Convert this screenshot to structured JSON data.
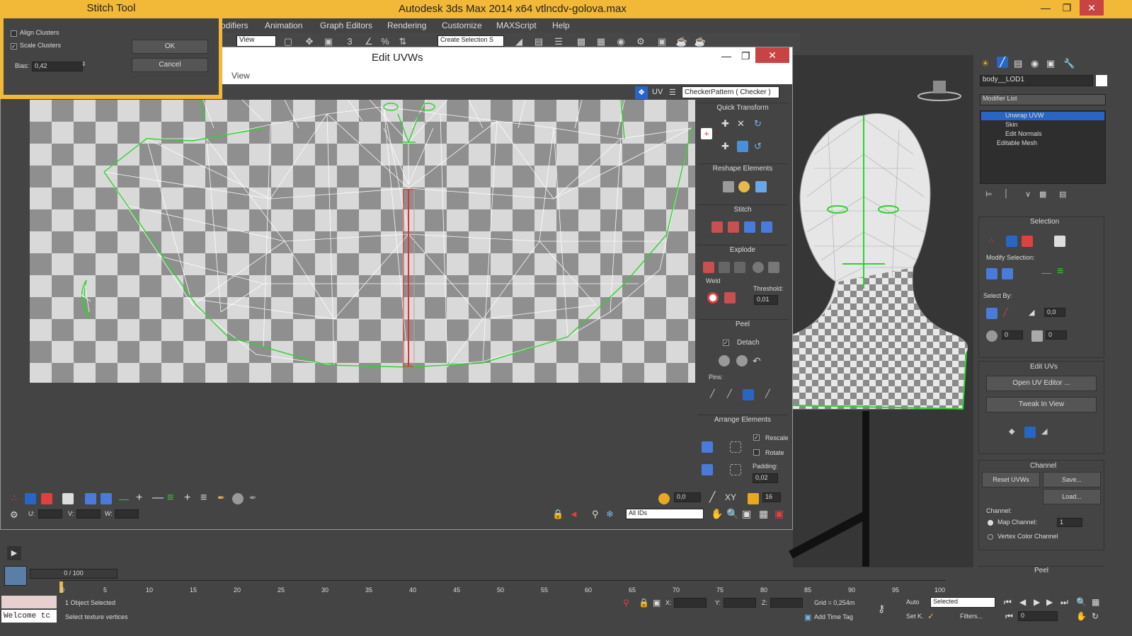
{
  "app": {
    "title": "Autodesk 3ds Max  2014 x64     vtlncdv-golova.max"
  },
  "menu": [
    "odifiers",
    "Animation",
    "Graph Editors",
    "Rendering",
    "Customize",
    "MAXScript",
    "Help"
  ],
  "toolbar": {
    "view_select": "View",
    "selection_set": "Create Selection S"
  },
  "stitch": {
    "title": "Stitch Tool",
    "align_clusters": "Align Clusters",
    "scale_clusters": "Scale Clusters",
    "ok": "OK",
    "cancel": "Cancel",
    "bias_label": "Bias:",
    "bias_value": "0,42"
  },
  "uvw": {
    "title": "Edit UVWs",
    "menu_view": "View",
    "uv_label": "UV",
    "texture": "CheckerPattern  ( Checker )",
    "sections": {
      "quick": "Quick Transform",
      "reshape": "Reshape Elements",
      "stitch": "Stitch",
      "explode": "Explode",
      "peel": "Peel",
      "arrange": "Arrange Elements"
    },
    "weld": "Weld",
    "threshold_label": "Threshold:",
    "threshold": "0,01",
    "detach": "Detach",
    "pins": "Pins:",
    "rescale": "Rescale",
    "rotate": "Rotate",
    "padding_label": "Padding:",
    "padding": "0,02",
    "bottom": {
      "u": "U:",
      "v": "V:",
      "w": "W:",
      "ids": "All IDs",
      "value": "0,0",
      "xy": "XY",
      "grid": "16"
    }
  },
  "cmd": {
    "object_name": "body__LOD1",
    "modifier_list": "Modifier List",
    "stack": [
      "Unwrap UVW",
      "Skin",
      "Edit Normals",
      "Editable Mesh"
    ],
    "selection": "Selection",
    "modify_selection": "Modify Selection:",
    "select_by": "Select By:",
    "select_val": "0,0",
    "sel_a": "0",
    "sel_b": "0",
    "edit_uvs": "Edit UVs",
    "open_uv": "Open UV Editor ...",
    "tweak": "Tweak In View",
    "channel": "Channel",
    "reset": "Reset UVWs",
    "save": "Save...",
    "load": "Load...",
    "channel_label": "Channel:",
    "map_channel": "Map Channel:",
    "map_value": "1",
    "vertex_color": "Vertex Color Channel",
    "peel": "Peel"
  },
  "timeline": {
    "frame": "0 / 100",
    "ticks": [
      "0",
      "5",
      "10",
      "15",
      "20",
      "25",
      "30",
      "35",
      "40",
      "45",
      "50",
      "55",
      "60",
      "65",
      "70",
      "75",
      "80",
      "85",
      "90",
      "95",
      "100"
    ]
  },
  "status": {
    "welcome": "Welcome tc",
    "selected": "1 Object Selected",
    "hint": "Select texture vertices",
    "x": "X:",
    "y": "Y:",
    "z": "Z:",
    "grid": "Grid = 0,254m",
    "auto": "Auto",
    "selected_dd": "Selected",
    "setk": "Set K.",
    "filters": "Filters...",
    "add_time_tag": "Add Time Tag",
    "frame_val": "0"
  }
}
